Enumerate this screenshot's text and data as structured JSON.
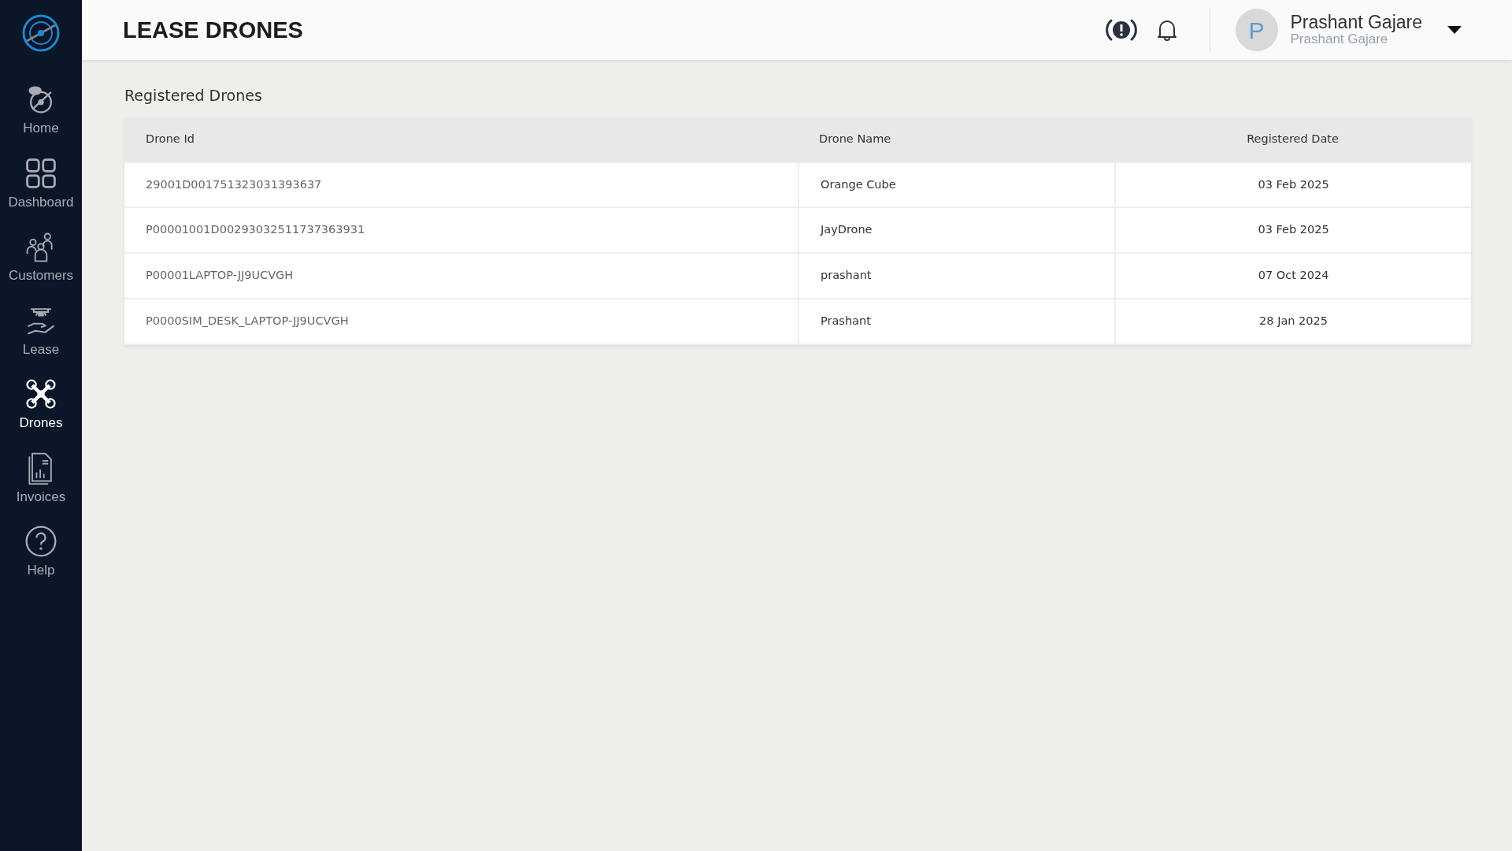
{
  "header": {
    "title": "LEASE DRONES",
    "user": {
      "name": "Prashant Gajare",
      "subtitle": "Prashant Gajare",
      "initial": "P"
    }
  },
  "sidebar": {
    "items": [
      {
        "kind": "home",
        "label": "Home",
        "selected": false
      },
      {
        "kind": "dashboard",
        "label": "Dashboard",
        "selected": false
      },
      {
        "kind": "customers",
        "label": "Customers",
        "selected": false
      },
      {
        "kind": "lease",
        "label": "Lease",
        "selected": false
      },
      {
        "kind": "drones",
        "label": "Drones",
        "selected": true
      },
      {
        "kind": "invoices",
        "label": "Invoices",
        "selected": false
      },
      {
        "kind": "help",
        "label": "Help",
        "selected": false
      }
    ]
  },
  "section_title": "Registered Drones",
  "table": {
    "columns": [
      "Drone Id",
      "Drone Name",
      "Registered Date"
    ],
    "rows": [
      [
        "29001D001751323031393637",
        "Orange Cube",
        "03 Feb 2025"
      ],
      [
        "P00001001D00293032511737363931",
        "JayDrone",
        "03 Feb 2025"
      ],
      [
        "P00001LAPTOP-JJ9UCVGH",
        "prashant",
        "07 Oct 2024"
      ],
      [
        "P0000SIM_DESK_LAPTOP-JJ9UCVGH",
        "Prashant",
        "28 Jan 2025"
      ]
    ]
  }
}
